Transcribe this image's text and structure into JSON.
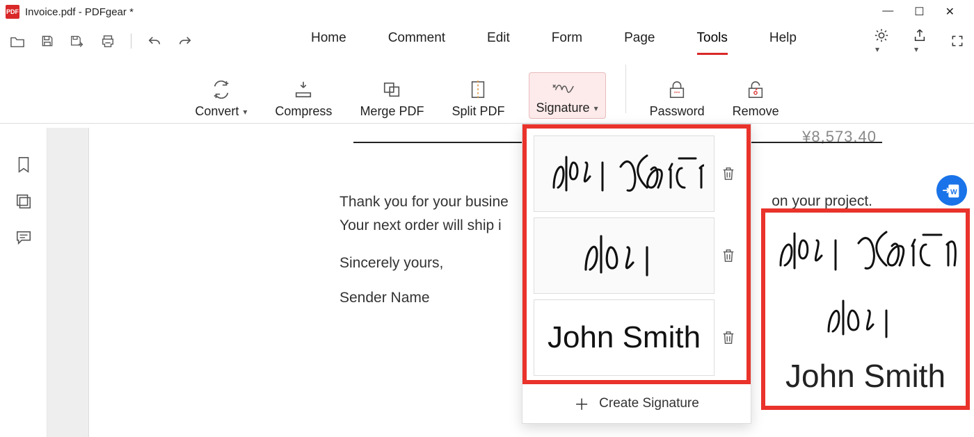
{
  "window": {
    "title": "Invoice.pdf - PDFgear *"
  },
  "menu": {
    "items": [
      "Home",
      "Comment",
      "Edit",
      "Form",
      "Page",
      "Tools",
      "Help"
    ],
    "active_index": 5
  },
  "ribbon": {
    "convert": "Convert",
    "compress": "Compress",
    "merge": "Merge PDF",
    "split": "Split PDF",
    "signature": "Signature",
    "password": "Password",
    "remove": "Remove"
  },
  "document": {
    "amount": "¥8,573.40",
    "line1": "Thank you for your busine",
    "line1_tail": "on your project.",
    "line2": "Your next order will ship i",
    "closing": "Sincerely yours,",
    "sender": "Sender Name"
  },
  "signature_panel": {
    "items": [
      {
        "kind": "cursive",
        "text": "John Smith"
      },
      {
        "kind": "cursive",
        "text": "John"
      },
      {
        "kind": "typed",
        "text": "John Smith"
      }
    ],
    "create_label": "Create Signature"
  },
  "right_box": {
    "cursive1": "John Smith",
    "cursive2": "John",
    "typed": "John Smith"
  }
}
